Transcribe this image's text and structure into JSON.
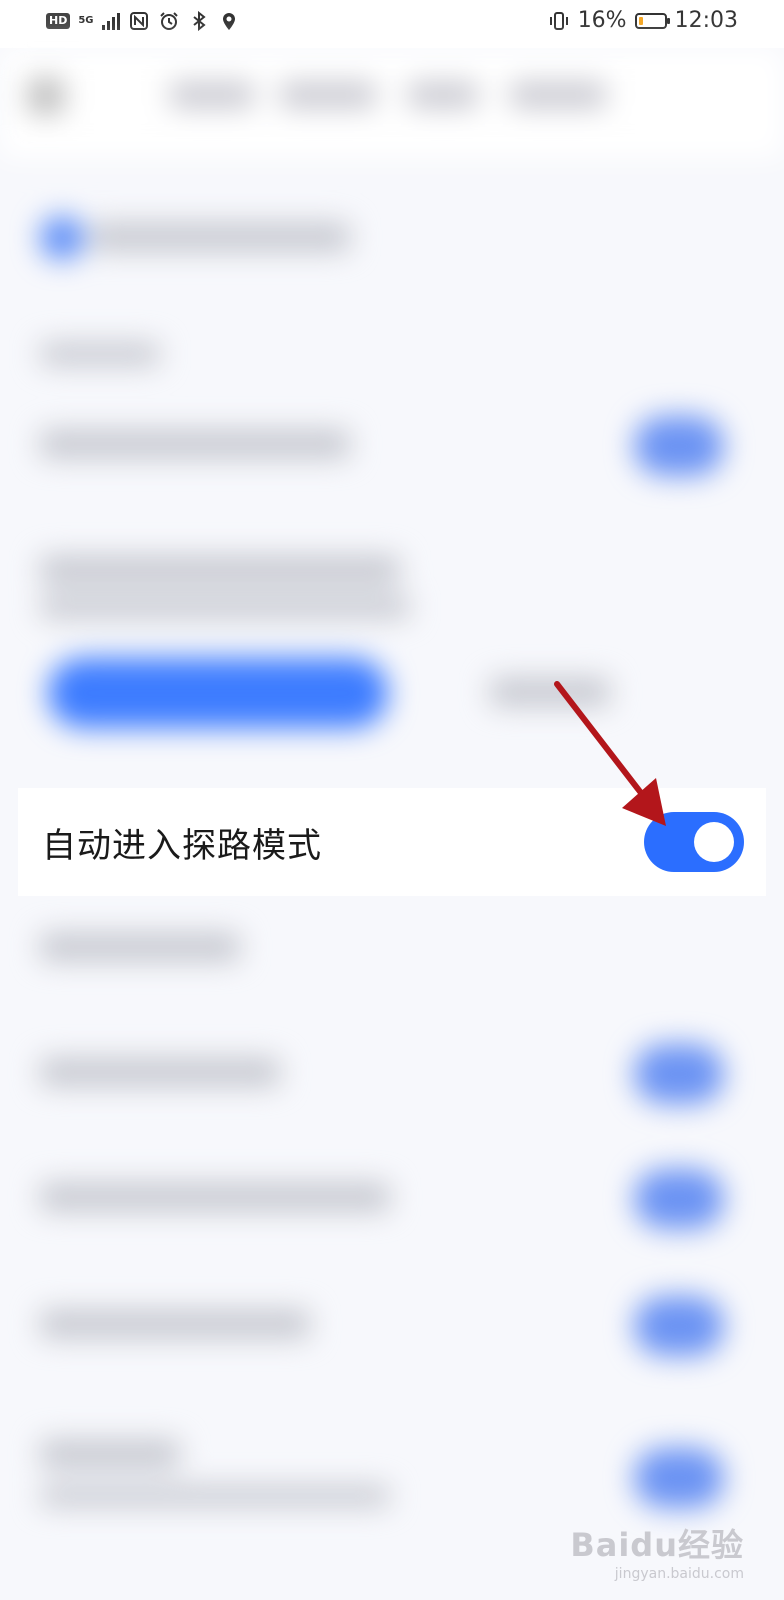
{
  "status_bar": {
    "hd": "HD",
    "network": "5G",
    "battery_percent": "16%",
    "time": "12:03",
    "battery_level": 0.16
  },
  "setting": {
    "label": "自动进入探路模式",
    "toggle_on": true
  },
  "colors": {
    "accent": "#2b6eff",
    "arrow": "#b3161b"
  },
  "watermark": {
    "main": "Baidu经验",
    "sub": "jingyan.baidu.com"
  }
}
